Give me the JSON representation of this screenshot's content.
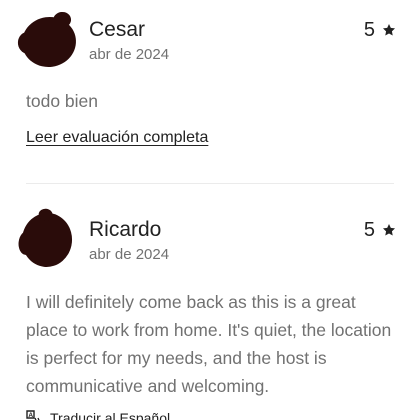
{
  "reviews": [
    {
      "name": "Cesar",
      "date": "abr de 2024",
      "rating": "5",
      "text": "todo bien",
      "read_more_label": "Leer evaluación completa"
    },
    {
      "name": "Ricardo",
      "date": "abr de 2024",
      "rating": "5",
      "text": "I will definitely come back as this is a great place to work from home. It's quiet, the location is perfect for my needs, and the host is communicative and welcoming."
    }
  ],
  "translate_label": "Traducir al Español",
  "icons": {
    "rating": "star-icon",
    "translate": "translate-icon"
  },
  "colors": {
    "primary_text": "#222222",
    "secondary_text": "#717171",
    "avatar": "#2a0c0a",
    "divider": "#ebebeb"
  }
}
